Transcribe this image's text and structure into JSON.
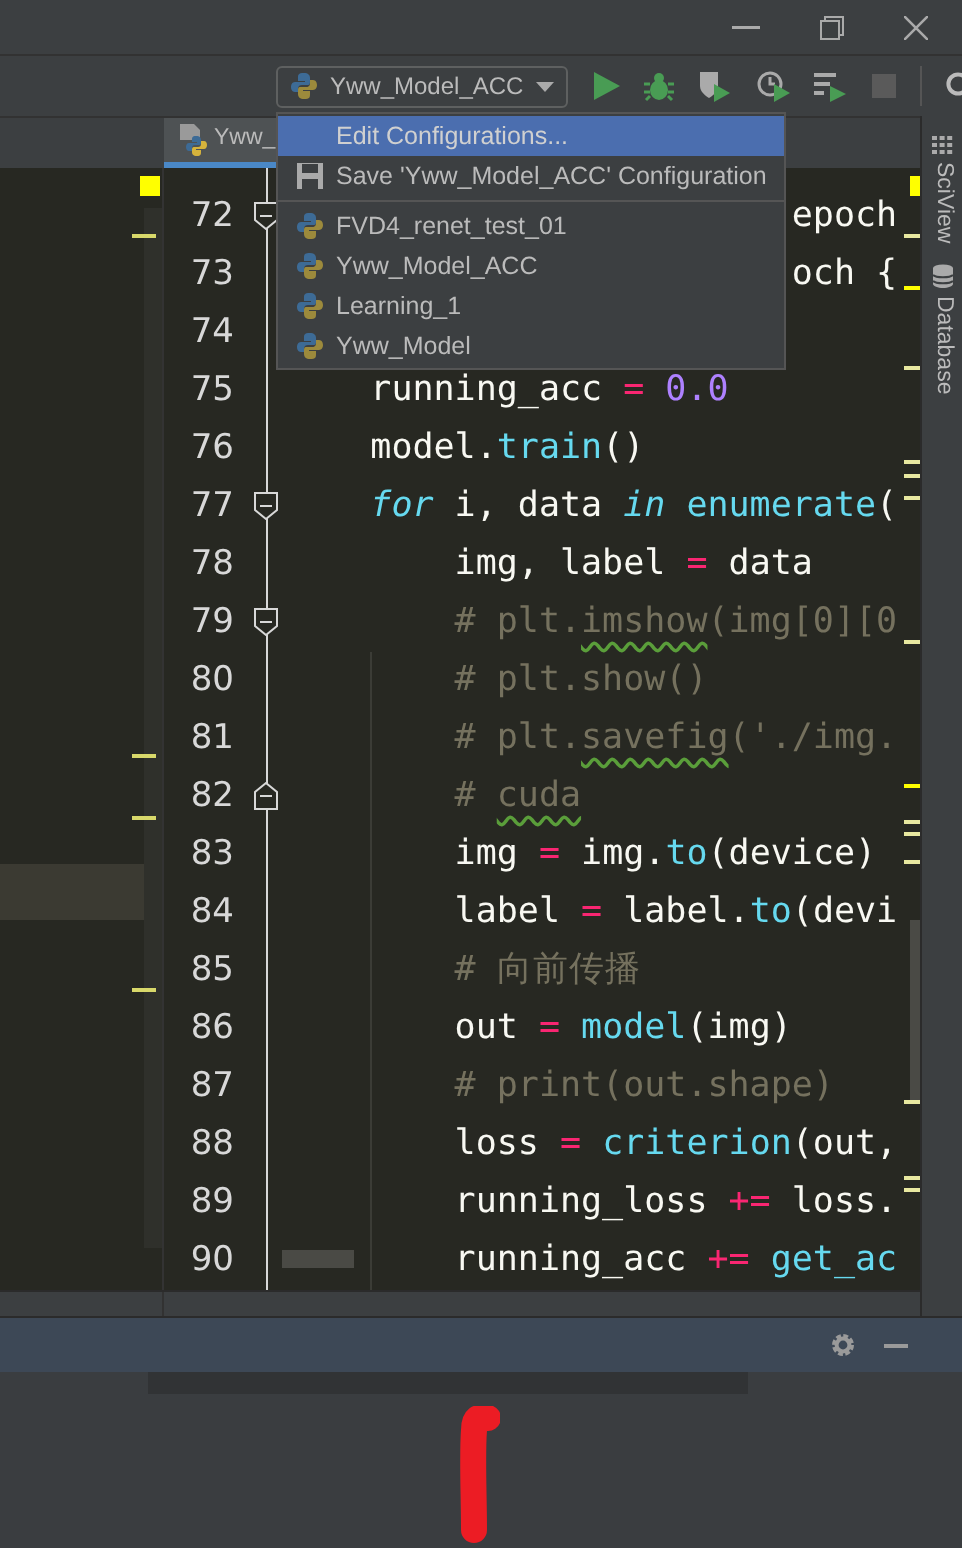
{
  "run_config": {
    "label": "Yww_Model_ACC"
  },
  "tab": {
    "label": "Yww_"
  },
  "menu": {
    "actions": [
      {
        "kind": "edit",
        "label": "Edit Configurations...",
        "selected": true
      },
      {
        "kind": "save",
        "label": "Save 'Yww_Model_ACC' Configuration",
        "selected": false
      }
    ],
    "configurations": [
      {
        "label": "FVD4_renet_test_01",
        "selected": false
      },
      {
        "label": "Yww_Model_ACC",
        "selected": false
      },
      {
        "label": "Learning_1",
        "selected": false
      },
      {
        "label": "Yww_Model",
        "selected": false
      }
    ]
  },
  "editor": {
    "lines": [
      {
        "number": "72",
        "fold_start": true,
        "tokens": [
          {
            "kind": "plain",
            "text": "                        epoch"
          }
        ]
      },
      {
        "number": "73",
        "tokens": [
          {
            "kind": "plain",
            "text": "                        och {"
          }
        ]
      },
      {
        "number": "74"
      },
      {
        "number": "75",
        "tokens": [
          {
            "kind": "plain",
            "text": "    running_acc "
          },
          {
            "kind": "op",
            "text": "= "
          },
          {
            "kind": "number",
            "text": "0.0"
          }
        ]
      },
      {
        "number": "76",
        "tokens": [
          {
            "kind": "plain",
            "text": "    model."
          },
          {
            "kind": "func",
            "text": "train"
          },
          {
            "kind": "plain",
            "text": "()"
          }
        ]
      },
      {
        "number": "77",
        "fold_start": true,
        "tokens": [
          {
            "kind": "keyword",
            "text": "    for"
          },
          {
            "kind": "plain",
            "text": " i, data "
          },
          {
            "kind": "keyword",
            "text": "in "
          },
          {
            "kind": "func",
            "text": "enumerate"
          },
          {
            "kind": "plain",
            "text": "("
          }
        ]
      },
      {
        "number": "78",
        "tokens": [
          {
            "kind": "plain",
            "text": "        img, label "
          },
          {
            "kind": "op",
            "text": "="
          },
          {
            "kind": "plain",
            "text": " data"
          }
        ]
      },
      {
        "number": "79",
        "fold_start": true,
        "tokens": [
          {
            "kind": "comment",
            "text": "        # plt."
          },
          {
            "kind": "comment",
            "text": "imshow",
            "squiggle": true
          },
          {
            "kind": "comment",
            "text": "(img[0][0"
          }
        ]
      },
      {
        "number": "80",
        "tokens": [
          {
            "kind": "comment",
            "text": "        # plt.show()"
          }
        ]
      },
      {
        "number": "81",
        "tokens": [
          {
            "kind": "comment",
            "text": "        # plt."
          },
          {
            "kind": "comment",
            "text": "savefig",
            "squiggle": true
          },
          {
            "kind": "comment",
            "text": "('./img."
          }
        ]
      },
      {
        "number": "82",
        "fold_end": true,
        "tokens": [
          {
            "kind": "comment",
            "text": "        # "
          },
          {
            "kind": "comment",
            "text": "cuda",
            "squiggle": true
          }
        ]
      },
      {
        "number": "83",
        "tokens": [
          {
            "kind": "plain",
            "text": "        img "
          },
          {
            "kind": "op",
            "text": "="
          },
          {
            "kind": "plain",
            "text": " img."
          },
          {
            "kind": "func",
            "text": "to"
          },
          {
            "kind": "plain",
            "text": "(device)"
          }
        ]
      },
      {
        "number": "84",
        "tokens": [
          {
            "kind": "plain",
            "text": "        label "
          },
          {
            "kind": "op",
            "text": "="
          },
          {
            "kind": "plain",
            "text": " label."
          },
          {
            "kind": "func",
            "text": "to"
          },
          {
            "kind": "plain",
            "text": "(devi"
          }
        ]
      },
      {
        "number": "85",
        "tokens": [
          {
            "kind": "comment",
            "text": "        # 向前传播"
          }
        ]
      },
      {
        "number": "86",
        "tokens": [
          {
            "kind": "plain",
            "text": "        out "
          },
          {
            "kind": "op",
            "text": "= "
          },
          {
            "kind": "func",
            "text": "model"
          },
          {
            "kind": "plain",
            "text": "(img)"
          }
        ]
      },
      {
        "number": "87",
        "tokens": [
          {
            "kind": "comment",
            "text": "        # print(out.shape)"
          }
        ]
      },
      {
        "number": "88",
        "tokens": [
          {
            "kind": "plain",
            "text": "        loss "
          },
          {
            "kind": "op",
            "text": "= "
          },
          {
            "kind": "func",
            "text": "criterion"
          },
          {
            "kind": "plain",
            "text": "(out,"
          }
        ]
      },
      {
        "number": "89",
        "tokens": [
          {
            "kind": "plain",
            "text": "        running_loss "
          },
          {
            "kind": "op",
            "text": "+="
          },
          {
            "kind": "plain",
            "text": " loss."
          }
        ]
      },
      {
        "number": "90",
        "tokens": [
          {
            "kind": "plain",
            "text": "        running_acc "
          },
          {
            "kind": "op",
            "text": "+= "
          },
          {
            "kind": "func",
            "text": "get_ac"
          }
        ]
      }
    ]
  },
  "sidebar": {
    "tabs": [
      {
        "kind": "sciview",
        "label": "SciView"
      },
      {
        "kind": "database",
        "label": "Database"
      }
    ]
  }
}
